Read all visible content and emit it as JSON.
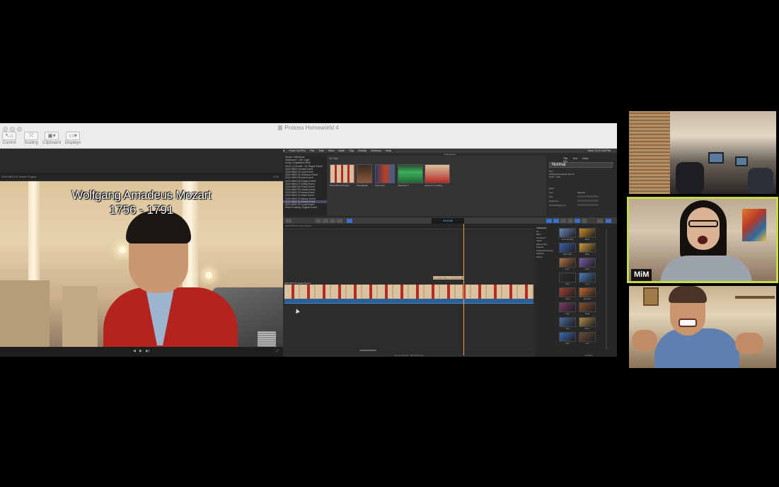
{
  "share": {
    "window_title": "Protoss Homeworld 4",
    "toolbar": [
      {
        "label": "Control",
        "icon": "pointer-icon"
      },
      {
        "label": "Scaling",
        "icon": "scaling-icon"
      },
      {
        "label": "Clipboard",
        "icon": "clipboard-icon"
      },
      {
        "label": "Displays",
        "icon": "display-icon"
      }
    ]
  },
  "viewer": {
    "project_label": "2020 MM CS Jessie Project",
    "zoom": "47%",
    "caption_name": "Wolfgang Amadeus Mozart",
    "caption_years": "1756 - 1791"
  },
  "fcp": {
    "menu": [
      "Final Cut Pro",
      "File",
      "Edit",
      "View",
      "Mark",
      "Clip",
      "Modify",
      "Window",
      "Help"
    ],
    "clock": "Wed 10:21:55 PM",
    "toolbar_title": "Final Cut Pro",
    "browser_header": "16 Clips",
    "library_items": [
      "Smart Collections",
      "Hollywood - Life Logic",
      "Song Compilation Rent",
      "2019 12 09 add - LK Skype Shoot",
      "2020 MM0 Pamela Event",
      "2020 MM0 03 Julia Event",
      "2020 MM0 04 Rebecca Event",
      "2020 MM0 05 Noel Event",
      "2020 MM0 06 Rujean Event",
      "2020 MM0 07 Shelly Event",
      "2020 MM0 08 Pedro Event",
      "2020 MM0 09 Hanifa Event",
      "2020 MM0 10 Nesta Event",
      "2020 MM0 11 Maria Event",
      "2020 MM0 12 Ashley Event",
      "2020 MM0 14 Jessie Event",
      "2020 MM0 15 Lunar Event",
      "Rami Fronting Original Event"
    ],
    "clips": [
      {
        "label": "2020 MM CS Project"
      },
      {
        "label": "Soundtrackr"
      },
      {
        "label": "Grid comp"
      },
      {
        "label": "Voiceover 1"
      },
      {
        "label": "Jessie b.1 Crafting"
      }
    ],
    "inspector": {
      "tabs": [
        "Title",
        "Text",
        "Video",
        "Info"
      ],
      "preset": "Normal",
      "text_lines": [
        "Text",
        "Wolfgang Amadeus Mozart",
        "1756 - 1791"
      ],
      "rows": [
        {
          "label": "Basic"
        },
        {
          "label": "Font",
          "value": "Papyrus"
        },
        {
          "label": "Size"
        },
        {
          "label": "Alignment"
        },
        {
          "label": "Vertical Alignment"
        }
      ]
    },
    "timecode": "6:13:28",
    "timeline": {
      "ruler_label": "2020 MM CS Jessie Project",
      "title_clip": "Basic Title: Wolfgang Amade...",
      "primary_label": "2020 MM CS Jessie Project",
      "status": "00:11 selected - 08:15:00 total"
    },
    "effects": {
      "header": "Transitions",
      "categories": [
        "All",
        "Blurs",
        "Dissolves",
        "Lights",
        "Movements",
        "Objects",
        "Replicator/Clones",
        "Stylized",
        "Wipes"
      ],
      "items": [
        "Cross Dissolve",
        "Black",
        "White Hole",
        "Wave",
        "Color",
        "Fade",
        "Flow",
        "Lens",
        "Cube",
        "Doorway",
        "Slide",
        "Swap",
        "Twirl",
        "Zoom",
        "Stars",
        "Cut"
      ],
      "footer": "73 items"
    }
  },
  "participants": [
    {
      "name": "",
      "role": "tile-1"
    },
    {
      "name": "MiM",
      "active_speaker": true,
      "highlight_color": "#c7d94a"
    },
    {
      "name": "",
      "role": "tile-3"
    }
  ]
}
